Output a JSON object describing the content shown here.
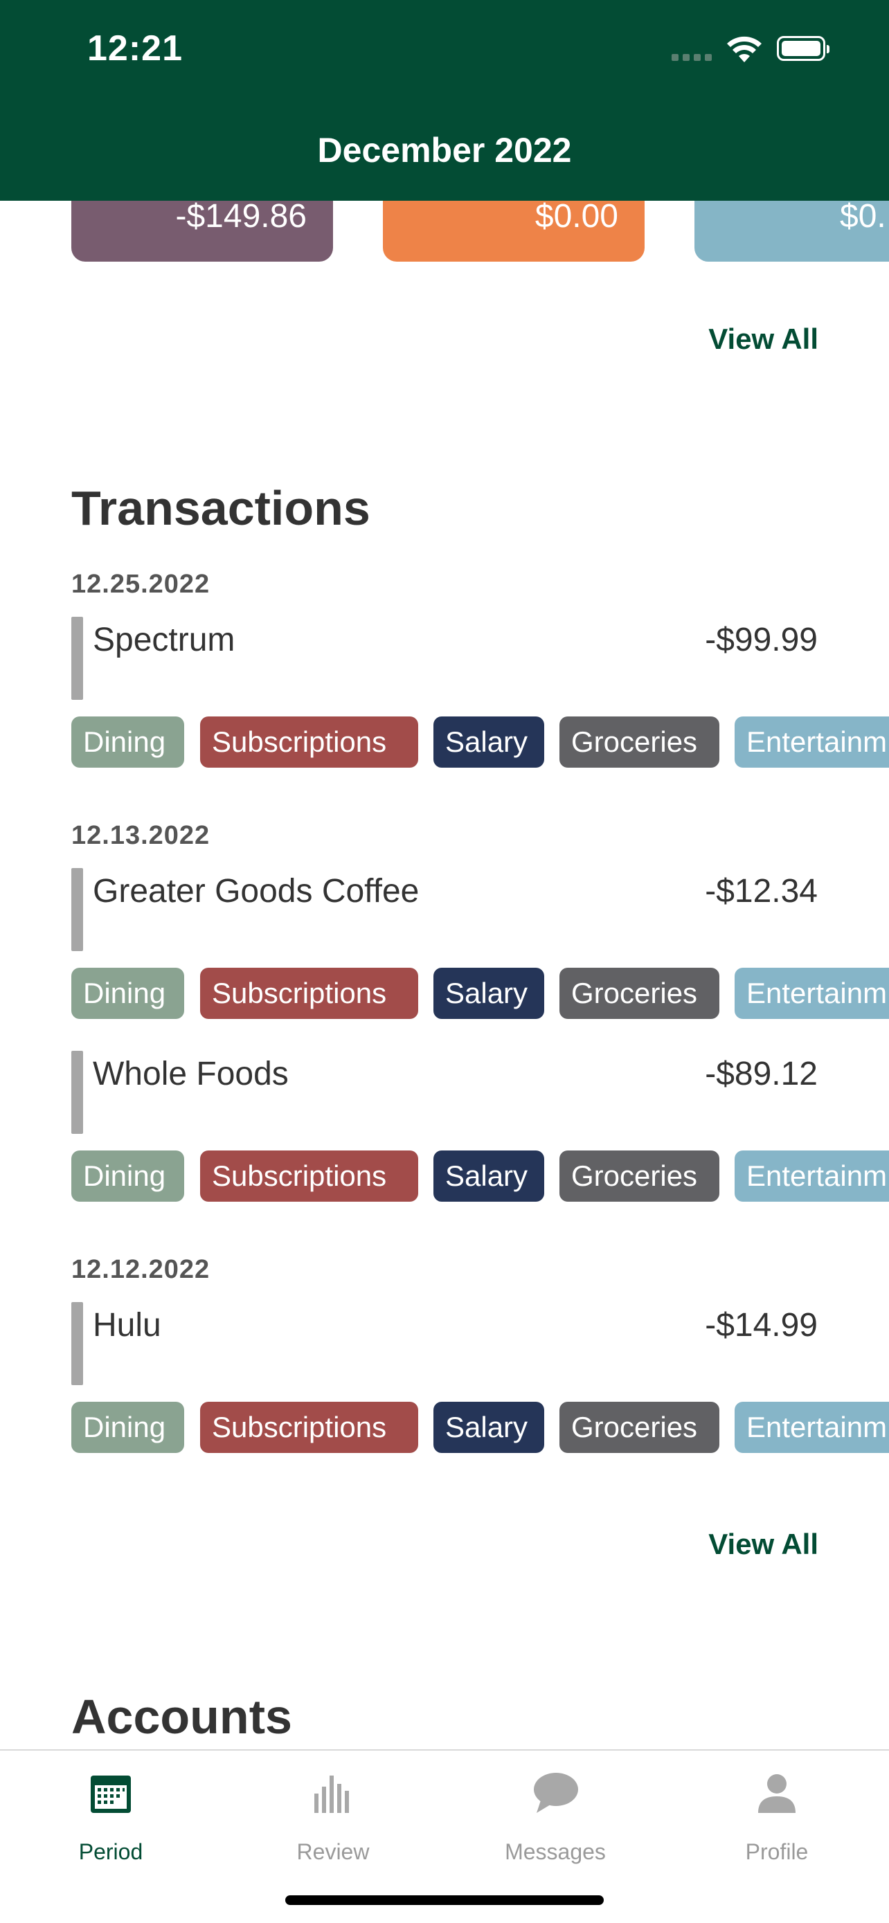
{
  "status_bar": {
    "time": "12:21"
  },
  "header": {
    "title": "December 2022"
  },
  "summary_cards": [
    {
      "amount": "-$149.86",
      "color": "#785c6f"
    },
    {
      "amount": "$0.00",
      "color": "#ee8348"
    },
    {
      "amount": "$0.",
      "color": "#85b5c6"
    }
  ],
  "view_all_top": "View All",
  "transactions": {
    "title": "Transactions",
    "tags": [
      "Dining",
      "Subscriptions",
      "Salary",
      "Groceries",
      "Entertainm"
    ],
    "groups": [
      {
        "date": "12.25.2022",
        "items": [
          {
            "name": "Spectrum",
            "amount": "-$99.99"
          }
        ]
      },
      {
        "date": "12.13.2022",
        "items": [
          {
            "name": "Greater Goods Coffee",
            "amount": "-$12.34"
          },
          {
            "name": "Whole Foods",
            "amount": "-$89.12"
          }
        ]
      },
      {
        "date": "12.12.2022",
        "items": [
          {
            "name": "Hulu",
            "amount": "-$14.99"
          }
        ]
      }
    ],
    "view_all": "View All"
  },
  "accounts": {
    "title": "Accounts"
  },
  "tabbar": {
    "items": [
      {
        "label": "Period",
        "icon": "calendar-icon",
        "active": true
      },
      {
        "label": "Review",
        "icon": "bar-chart-icon",
        "active": false
      },
      {
        "label": "Messages",
        "icon": "speech-bubble-icon",
        "active": false
      },
      {
        "label": "Profile",
        "icon": "person-icon",
        "active": false
      }
    ]
  },
  "colors": {
    "brand": "#034c34",
    "tag_dining": "#8aa391",
    "tag_subscriptions": "#a24c4a",
    "tag_salary": "#253558",
    "tag_groceries": "#616164",
    "tag_entertainment": "#86b5c8"
  }
}
